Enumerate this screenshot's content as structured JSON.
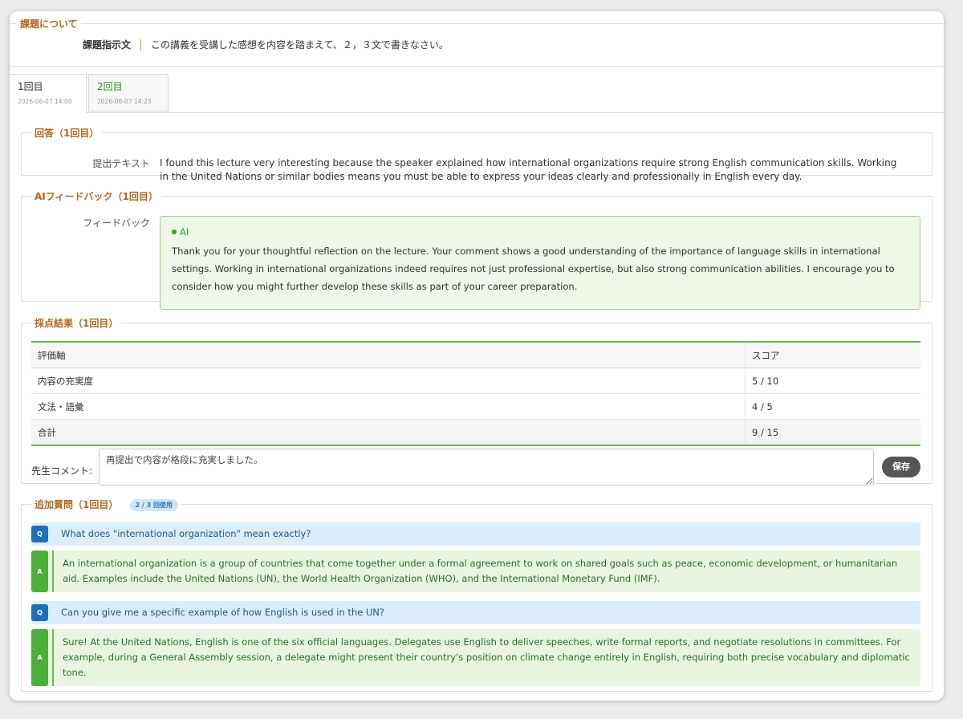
{
  "task": {
    "section_title": "課題について",
    "label": "課題指示文",
    "text": "この講義を受講した感想を内容を踏まえて、２，３文で書きなさい。"
  },
  "tabs": [
    {
      "label": "1回目",
      "date": "2026-06-07 14:00"
    },
    {
      "label": "2回目",
      "date": "2026-06-07 14:23"
    }
  ],
  "answer": {
    "section_title": "回答（1回目）",
    "label": "提出テキスト",
    "text": "I found this lecture very interesting because the speaker explained how international organizations require strong English communication skills. Working in the United Nations or similar bodies means you must be able to express your ideas clearly and professionally in English every day."
  },
  "feedback": {
    "section_title": "AIフィードバック（1回目）",
    "label": "フィードバック",
    "source": "AI",
    "text": "Thank you for your thoughtful reflection on the lecture. Your comment shows a good understanding of the importance of language skills in international settings. Working in international organizations indeed requires not just professional expertise, but also strong communication abilities. I encourage you to consider how you might further develop these skills as part of your career preparation."
  },
  "score": {
    "section_title": "採点結果（1回目）",
    "headers": [
      "評価軸",
      "スコア"
    ],
    "rows": [
      {
        "axis": "内容の充実度",
        "score": "5 / 10"
      },
      {
        "axis": "文法・語彙",
        "score": "4 / 5"
      }
    ],
    "total": {
      "axis": "合計",
      "score": "9 / 15"
    },
    "comment_label": "先生コメント:",
    "comment_value": "再提出で内容が格段に充実しました。",
    "save_label": "保存"
  },
  "questions": {
    "section_title": "追加質問（1回目）",
    "usage_badge": "2 / 3 回使用",
    "q_icon": "Q",
    "a_icon": "A",
    "items": [
      {
        "q": "What does \"international organization\" mean exactly?",
        "a": "An international organization is a group of countries that come together under a formal agreement to work on shared goals such as peace, economic development, or humanitarian aid. Examples include the United Nations (UN), the World Health Organization (WHO), and the International Monetary Fund (IMF)."
      },
      {
        "q": "Can you give me a specific example of how English is used in the UN?",
        "a": "Sure! At the United Nations, English is one of the six official languages. Delegates use English to deliver speeches, write formal reports, and negotiate resolutions in committees. For example, during a General Assembly session, a delegate might present their country's position on climate change entirely in English, requiring both precise vocabulary and diplomatic tone."
      }
    ]
  },
  "colors": {
    "legend": "#b5651d",
    "accent_green": "#6db35a",
    "question_blue": "#1d6fb8",
    "answer_green": "#4caf3a"
  }
}
